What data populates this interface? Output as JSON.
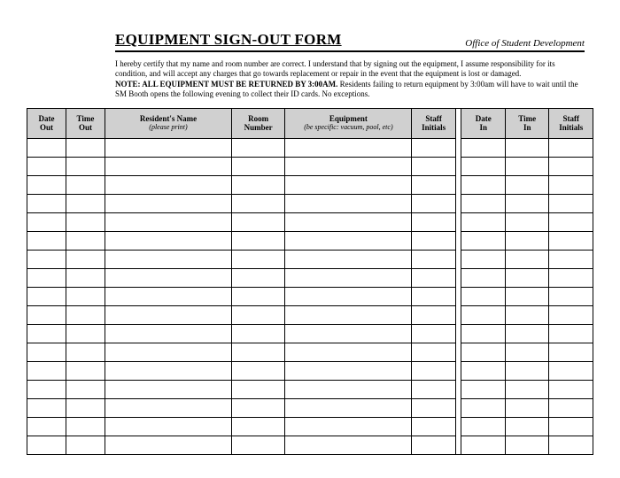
{
  "header": {
    "title": "EQUIPMENT SIGN-OUT FORM",
    "office": "Office of Student Development"
  },
  "disclaimer": {
    "p1": "I hereby certify that my name and room number are correct. I understand that by signing out the equipment, I assume responsibility for its condition, and will accept any charges that go towards replacement or repair in the event that the equipment is lost or damaged.",
    "note_label": "NOTE: ALL EQUIPMENT MUST BE RETURNED BY 3:00AM.",
    "note_rest": " Residents failing to return equipment by 3:00am will have to wait until the SM Booth opens the following evening to collect their ID cards. No exceptions."
  },
  "columns": {
    "date_out": {
      "line1": "Date",
      "line2": "Out"
    },
    "time_out": {
      "line1": "Time",
      "line2": "Out"
    },
    "name": {
      "line1": "Resident's Name",
      "sub": "(please print)"
    },
    "room": {
      "line1": "Room",
      "line2": "Number"
    },
    "equipment": {
      "line1": "Equipment",
      "sub": "(be specific: vacuum, pool, etc)"
    },
    "staff_out": {
      "line1": "Staff",
      "line2": "Initials"
    },
    "date_in": {
      "line1": "Date",
      "line2": "In"
    },
    "time_in": {
      "line1": "Time",
      "line2": "In"
    },
    "staff_in": {
      "line1": "Staff",
      "line2": "Initials"
    }
  },
  "row_count": 17
}
